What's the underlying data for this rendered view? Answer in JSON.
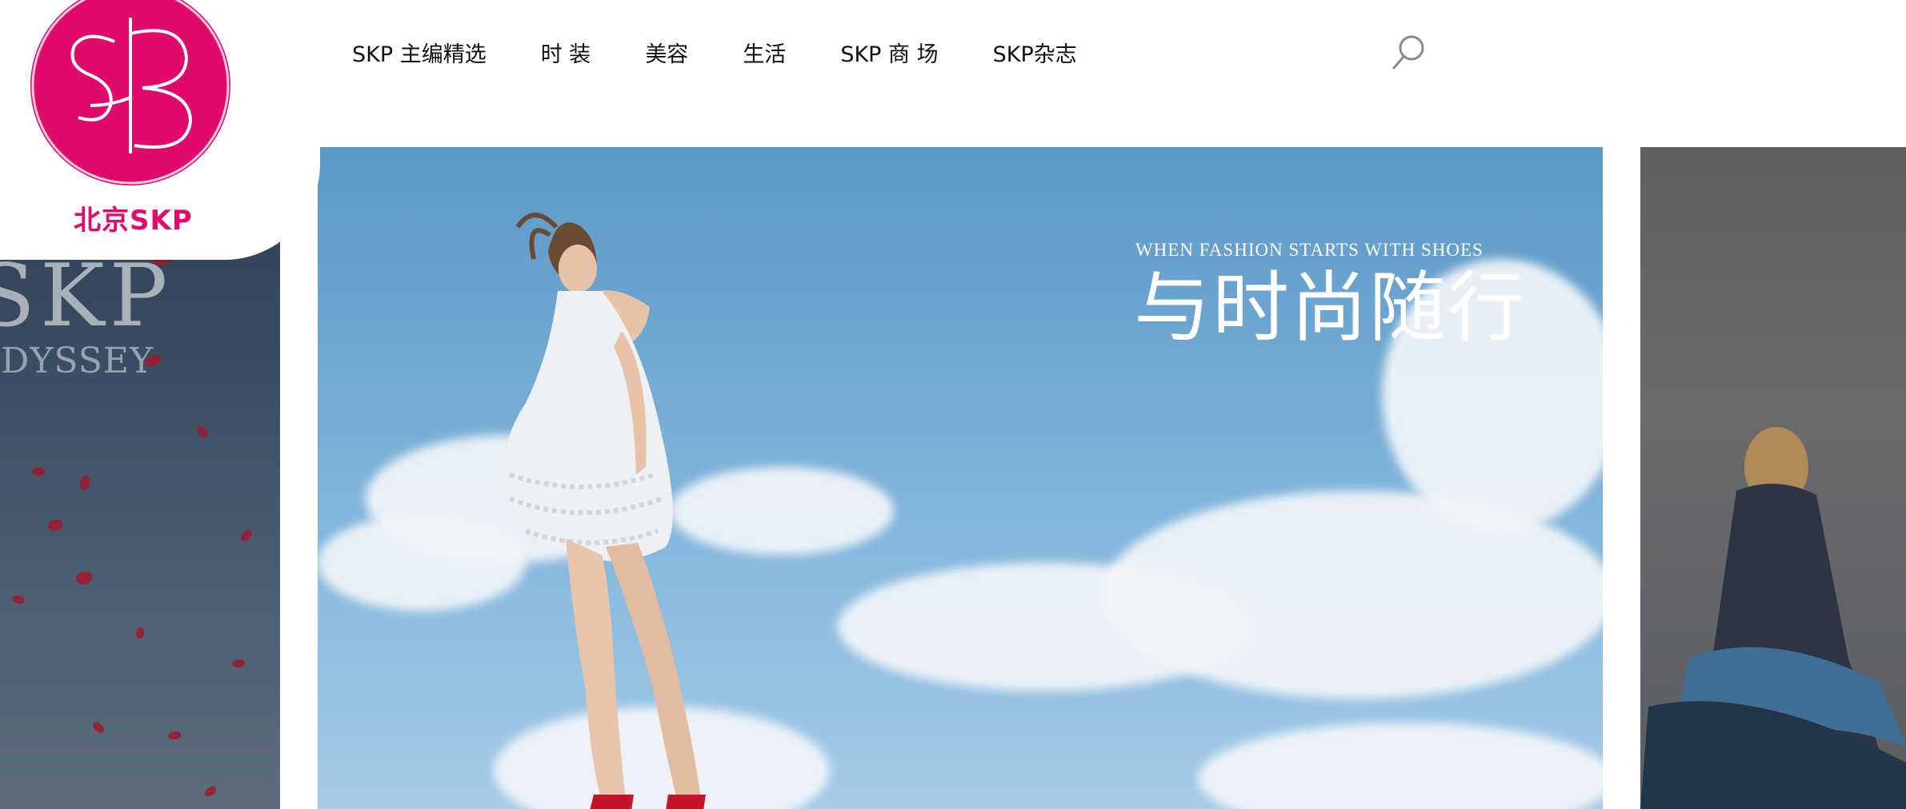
{
  "logo": {
    "text": "北京SKP",
    "color": "#e0096c"
  },
  "nav": {
    "items": [
      {
        "label": "SKP 主编精选"
      },
      {
        "label": "时 装"
      },
      {
        "label": "美容"
      },
      {
        "label": "生活"
      },
      {
        "label": "SKP 商 场"
      },
      {
        "label": "SKP杂志"
      }
    ],
    "search_icon": "search-icon"
  },
  "carousel": {
    "prev_slide": {
      "title": "SKP",
      "subtitle": "ODYSSEY"
    },
    "current_slide": {
      "subtitle": "WHEN FASHION STARTS WITH SHOES",
      "title": "与时尚随行"
    }
  },
  "colors": {
    "brand": "#e0096c",
    "sky": "#6fa7d1",
    "text": "#111111"
  }
}
